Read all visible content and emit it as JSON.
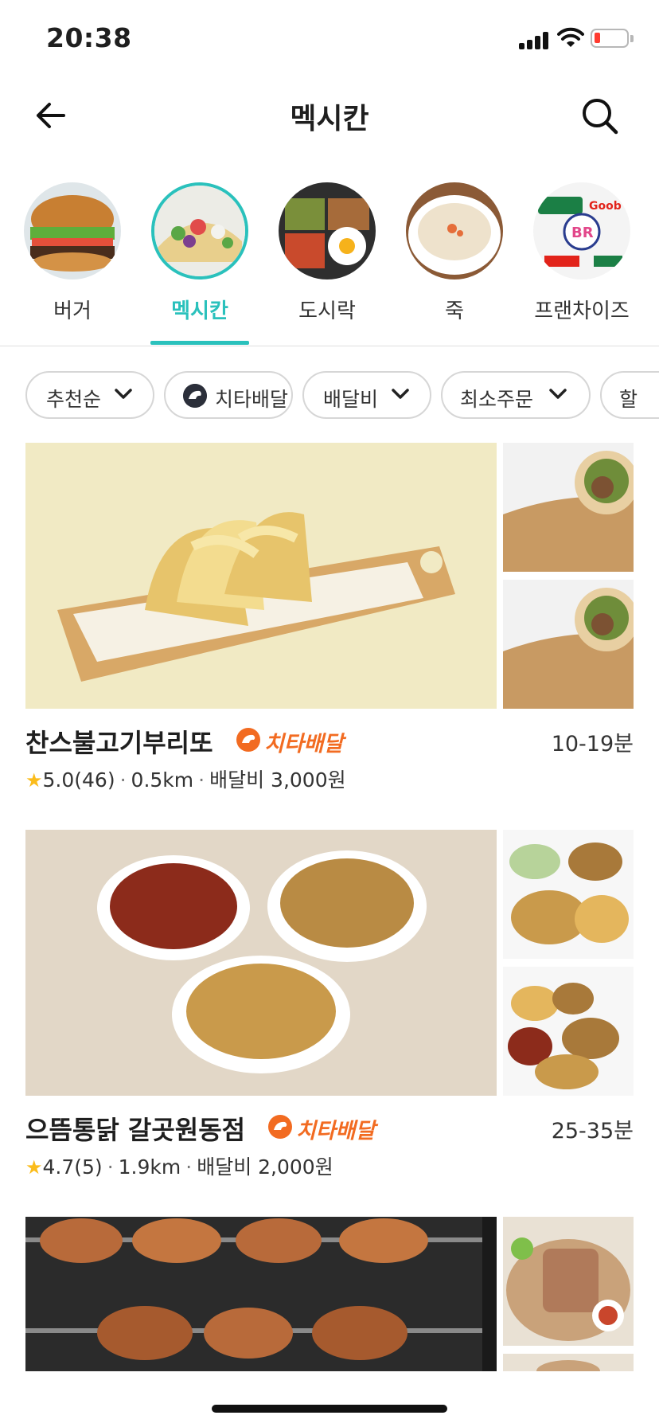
{
  "status_bar": {
    "time": "20:38"
  },
  "header": {
    "title": "멕시칸"
  },
  "categories": [
    {
      "label": "버거"
    },
    {
      "label": "멕시칸",
      "active": true
    },
    {
      "label": "도시락"
    },
    {
      "label": "죽"
    },
    {
      "label": "프랜차이즈"
    }
  ],
  "filters": [
    {
      "label": "추천순"
    },
    {
      "label": "치타배달"
    },
    {
      "label": "배달비"
    },
    {
      "label": "최소주문"
    },
    {
      "label": "할"
    }
  ],
  "listings": [
    {
      "name": "찬스불고기부리또",
      "badge": "치타배달",
      "time": "10-19분",
      "rating": "5.0(46)",
      "distance": "0.5km",
      "delivery_fee": "배달비 3,000원"
    },
    {
      "name": "으뜸통닭 갈곳원동점",
      "badge": "치타배달",
      "time": "25-35분",
      "rating": "4.7(5)",
      "distance": "1.9km",
      "delivery_fee": "배달비 2,000원"
    }
  ],
  "colors": {
    "accent": "#2ac1bc",
    "cheetah": "#f26b21",
    "star": "#fbbc1b"
  }
}
